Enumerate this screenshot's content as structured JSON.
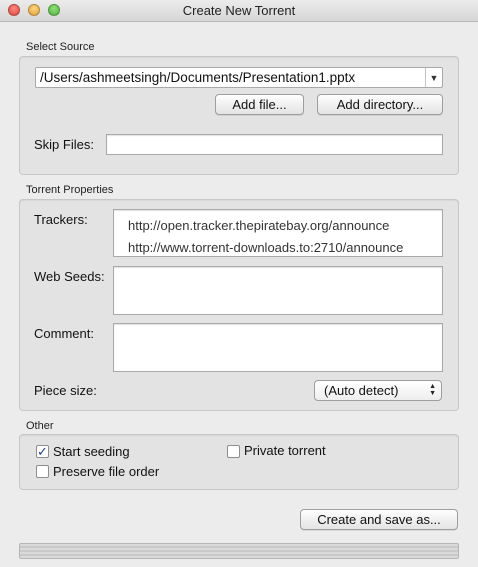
{
  "window": {
    "title": "Create New Torrent"
  },
  "source": {
    "section_label": "Select Source",
    "path_value": "/Users/ashmeetsingh/Documents/Presentation1.pptx",
    "add_file_label": "Add file...",
    "add_directory_label": "Add directory...",
    "skip_files_label": "Skip Files:",
    "skip_files_value": ""
  },
  "properties": {
    "section_label": "Torrent Properties",
    "trackers_label": "Trackers:",
    "trackers": [
      "http://open.tracker.thepiratebay.org/announce",
      "http://www.torrent-downloads.to:2710/announce"
    ],
    "web_seeds_label": "Web Seeds:",
    "comment_label": "Comment:",
    "piece_size_label": "Piece size:",
    "piece_size_value": "(Auto detect)"
  },
  "other": {
    "section_label": "Other",
    "start_seeding_label": "Start seeding",
    "start_seeding_checked": true,
    "private_torrent_label": "Private torrent",
    "private_torrent_checked": false,
    "preserve_order_label": "Preserve file order",
    "preserve_order_checked": false
  },
  "actions": {
    "create_label": "Create and save as..."
  }
}
